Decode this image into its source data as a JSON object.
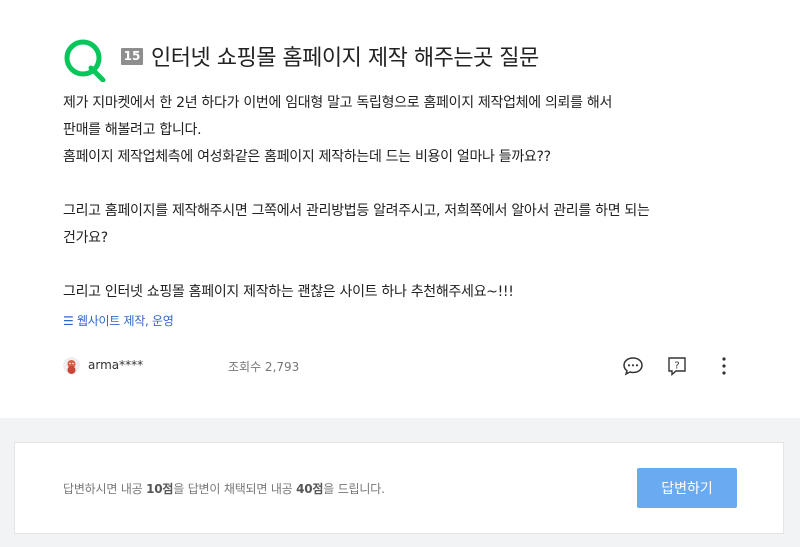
{
  "question": {
    "badge": "15",
    "title": "인터넷 쇼핑몰 홈페이지 제작 해주는곳 질문",
    "body": {
      "line1": "제가 지마켓에서 한 2년 하다가 이번에 임대형 말고 독립형으로 홈페이지 제작업체에 의뢰를 해서",
      "line2": "판매를 해볼려고 합니다.",
      "line3": "홈페이지 제작업체측에 여성화같은 홈페이지 제작하는데 드는 비용이 얼마나 들까요??",
      "line4": "그리고 홈페이지를 제작해주시면 그쪽에서 관리방법등 알려주시고, 저희쪽에서 알아서 관리를 하면 되는",
      "line5": "건가요?",
      "line6": "그리고 인터넷 쇼핑몰 홈페이지 제작하는 괜찮은 사이트 하나 추천해주세요~!!!"
    },
    "tag": "웹사이트 제작, 운영",
    "author": "arma****",
    "views": "조회수 2,793"
  },
  "answer": {
    "info_prefix": "답변하시면 내공 ",
    "info_points1": "10점",
    "info_middle": "을 답변이 채택되면 내공 ",
    "info_points2": "40점",
    "info_suffix": "을 드립니다.",
    "button": "답변하기"
  },
  "colors": {
    "logo_green": "#03c75a",
    "tag_blue": "#3366cc",
    "answer_button": "#6aaaf0"
  }
}
